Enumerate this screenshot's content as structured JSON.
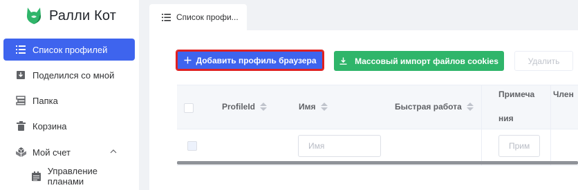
{
  "brand": {
    "name": "Ралли Кот",
    "logo_color": "#2fb56a"
  },
  "sidebar": {
    "items": [
      {
        "label": "Список профилей",
        "icon": "list-icon",
        "active": true
      },
      {
        "label": "Поделился со мной",
        "icon": "download-box-icon"
      },
      {
        "label": "Папка",
        "icon": "folder-stack-icon"
      },
      {
        "label": "Корзина",
        "icon": "trash-icon"
      },
      {
        "label": "Мой счет",
        "icon": "cubes-icon",
        "expanded": true
      }
    ],
    "subitems": [
      {
        "label": "Управление планами",
        "icon": "calendar-icon"
      }
    ]
  },
  "tab": {
    "label": "Список профи..."
  },
  "toolbar": {
    "add_label": "Добавить профиль браузера",
    "import_label": "Массовый импорт файлов cookies",
    "delete_label": "Удалить"
  },
  "table": {
    "columns": {
      "profile_id": "ProfileId",
      "name": "Имя",
      "quick_work": "Быстрая работа",
      "note_line1": "Примеча",
      "note_line2": "ния",
      "member": "Член"
    },
    "filters": {
      "name_placeholder": "Имя",
      "note_placeholder": "Прим"
    }
  },
  "colors": {
    "accent": "#3e64ee",
    "success": "#2fb56a",
    "highlight_border": "#e02020"
  }
}
